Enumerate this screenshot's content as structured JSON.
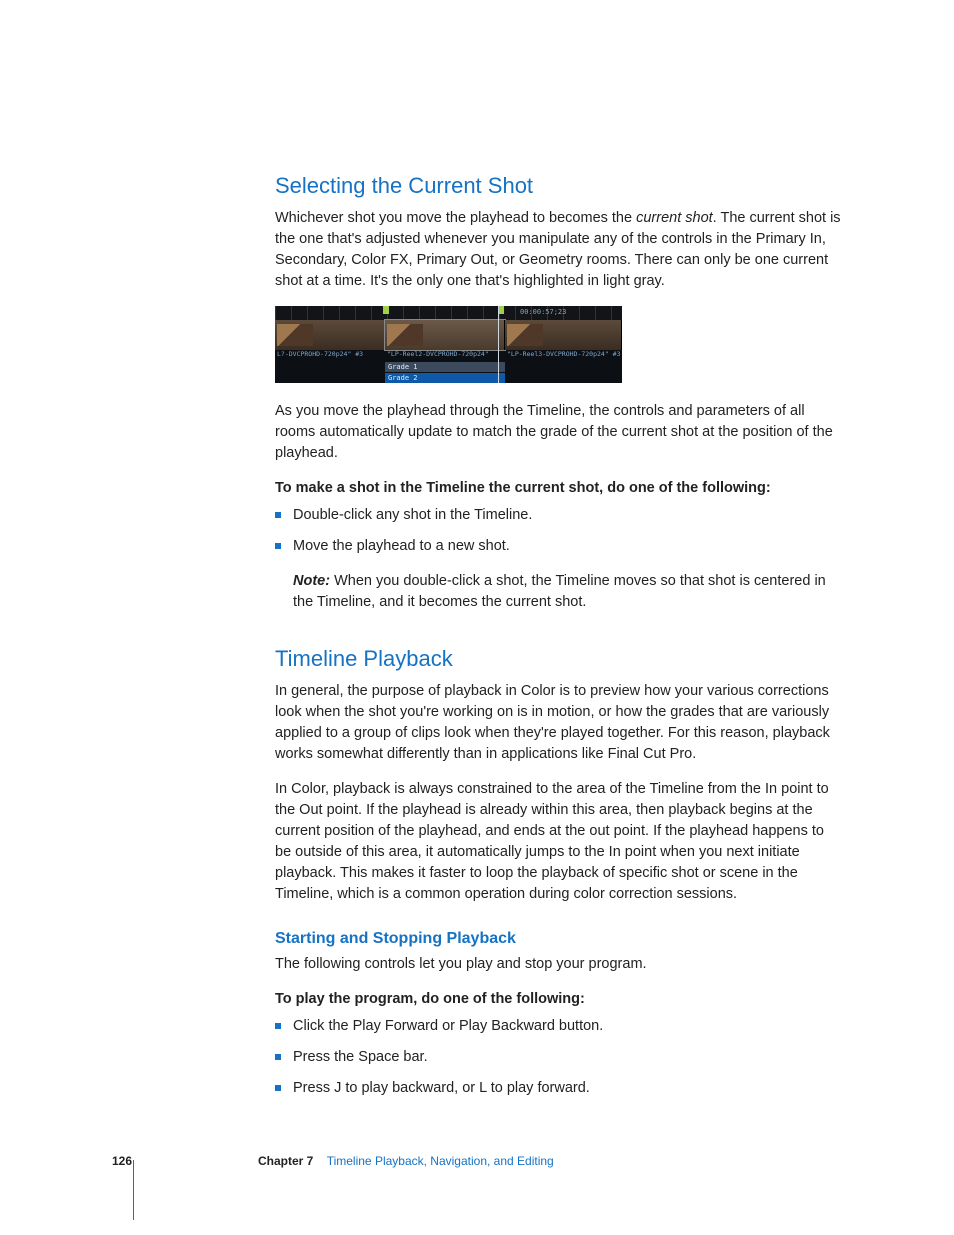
{
  "section1": {
    "heading": "Selecting the Current Shot",
    "para1a": "Whichever shot you move the playhead to becomes the ",
    "para1b": "current shot",
    "para1c": ". The current shot is the one that's adjusted whenever you manipulate any of the controls in the Primary In, Secondary, Color FX, Primary Out, or Geometry rooms. There can only be one current shot at a time. It's the only one that's highlighted in light gray.",
    "para2": "As you move the playhead through the Timeline, the controls and parameters of all rooms automatically update to match the grade of the current shot at the position of the playhead.",
    "instruction": "To make a shot in the Timeline the current shot, do one of the following:",
    "bullets": [
      "Double-click any shot in the Timeline.",
      "Move the playhead to a new shot."
    ],
    "note_label": "Note:",
    "note_text": "  When you double-click a shot, the Timeline moves so that shot is centered in the Timeline, and it becomes the current shot."
  },
  "screenshot": {
    "timecode": "00:00:57;23",
    "clip_labels": [
      "L?-DVCPROHD-720p24\" #3",
      "\"LP-Reel2-DVCPROHD-720p24\"",
      "\"LP-Reel3-DVCPROHD-720p24\" #3"
    ],
    "grade1": "Grade 1",
    "grade2": "Grade 2"
  },
  "section2": {
    "heading": "Timeline Playback",
    "para1": "In general, the purpose of playback in Color is to preview how your various corrections look when the shot you're working on is in motion, or how the grades that are variously applied to a group of clips look when they're played together. For this reason, playback works somewhat differently than in applications like Final Cut Pro.",
    "para2": "In Color, playback is always constrained to the area of the Timeline from the In point to the Out point. If the playhead is already within this area, then playback begins at the current position of the playhead, and ends at the out point. If the playhead happens to be outside of this area, it automatically jumps to the In point when you next initiate playback. This makes it faster to loop the playback of specific shot or scene in the Timeline, which is a common operation during color correction sessions.",
    "sub": {
      "heading": "Starting and Stopping Playback",
      "para": "The following controls let you play and stop your program.",
      "instruction": "To play the program, do one of the following:",
      "bullets": [
        "Click the Play Forward or Play Backward button.",
        "Press the Space bar.",
        "Press J to play backward, or L to play forward."
      ]
    }
  },
  "footer": {
    "page": "126",
    "chapter_label": "Chapter 7",
    "chapter_title": "Timeline Playback, Navigation, and Editing"
  }
}
